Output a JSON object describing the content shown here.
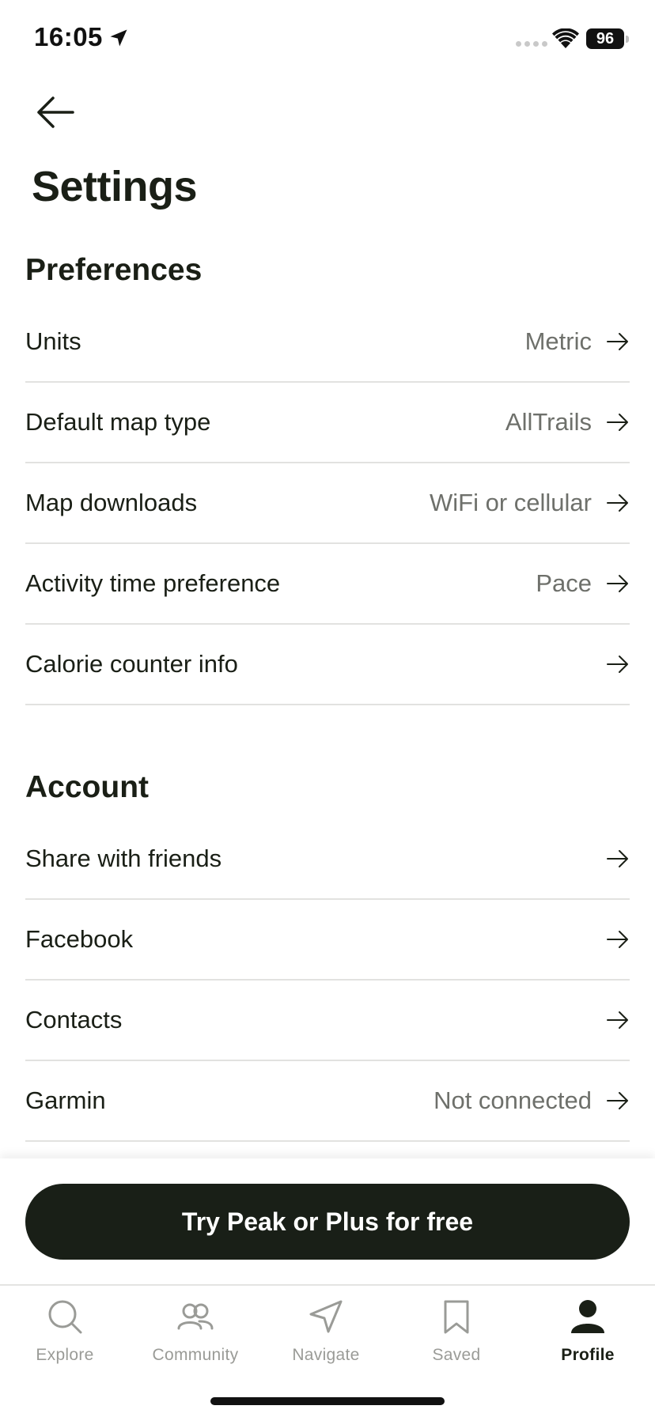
{
  "status_bar": {
    "time": "16:05",
    "battery": "96"
  },
  "header": {
    "title": "Settings"
  },
  "preferences": {
    "heading": "Preferences",
    "items": [
      {
        "label": "Units",
        "value": "Metric"
      },
      {
        "label": "Default map type",
        "value": "AllTrails"
      },
      {
        "label": "Map downloads",
        "value": "WiFi or cellular"
      },
      {
        "label": "Activity time preference",
        "value": "Pace"
      },
      {
        "label": "Calorie counter info",
        "value": ""
      }
    ]
  },
  "account": {
    "heading": "Account",
    "items": [
      {
        "label": "Share with friends",
        "value": ""
      },
      {
        "label": "Facebook",
        "value": ""
      },
      {
        "label": "Contacts",
        "value": ""
      },
      {
        "label": "Garmin",
        "value": "Not connected"
      }
    ]
  },
  "cta": {
    "label": "Try Peak or Plus for free"
  },
  "tab_bar": {
    "tabs": [
      {
        "label": "Explore",
        "icon": "search-icon"
      },
      {
        "label": "Community",
        "icon": "people-icon"
      },
      {
        "label": "Navigate",
        "icon": "navigate-icon"
      },
      {
        "label": "Saved",
        "icon": "bookmark-icon"
      },
      {
        "label": "Profile",
        "icon": "profile-icon",
        "active": true
      }
    ]
  },
  "colors": {
    "text": "#1a1f16",
    "muted": "#6e706b",
    "divider": "#e2e2e0",
    "cta_bg": "#191f17",
    "tab_inactive": "#9a9b97"
  }
}
